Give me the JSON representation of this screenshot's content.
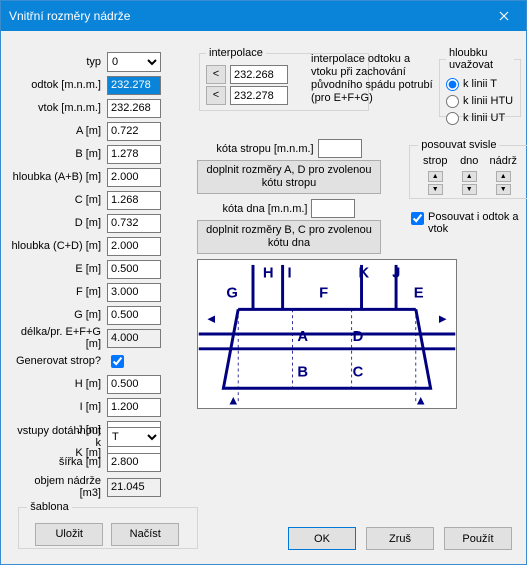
{
  "title": "Vnitřní rozměry nádrže",
  "fields": {
    "typ": {
      "label": "typ",
      "value": "0"
    },
    "odtok": {
      "label": "odtok [m.n.m.]",
      "value": "232.278"
    },
    "vtok": {
      "label": "vtok [m.n.m.]",
      "value": "232.268"
    },
    "A": {
      "label": "A [m]",
      "value": "0.722"
    },
    "B": {
      "label": "B [m]",
      "value": "1.278"
    },
    "AB": {
      "label": "hloubka (A+B) [m]",
      "value": "2.000"
    },
    "C": {
      "label": "C [m]",
      "value": "1.268"
    },
    "D": {
      "label": "D [m]",
      "value": "0.732"
    },
    "CD": {
      "label": "hloubka (C+D) [m]",
      "value": "2.000"
    },
    "E": {
      "label": "E [m]",
      "value": "0.500"
    },
    "F": {
      "label": "F [m]",
      "value": "3.000"
    },
    "G": {
      "label": "G [m]",
      "value": "0.500"
    },
    "EFG": {
      "label": "délka/pr. E+F+G [m]",
      "value": "4.000"
    },
    "gen": {
      "label": "Generovat strop?"
    },
    "H": {
      "label": "H [m]",
      "value": "0.500"
    },
    "I": {
      "label": "I [m]",
      "value": "1.200"
    },
    "J": {
      "label": "J [m]",
      "value": ""
    },
    "K": {
      "label": "K [m]",
      "value": ""
    }
  },
  "interp": {
    "legend": "interpolace",
    "v1": "232.268",
    "v2": "232.278",
    "desc": "interpolace odtoku a vtoku při zachování původního spádu potrubí (pro E+F+G)"
  },
  "depth": {
    "legend": "hloubku uvažovat",
    "opt1": "k linii T",
    "opt2": "k linii HTU",
    "opt3": "k linii UT"
  },
  "kota1": {
    "label": "kóta stropu [m.n.m.]",
    "btn": "doplnit rozměry A, D pro zvolenou kótu stropu"
  },
  "kota2": {
    "label": "kóta dna [m.n.m.]",
    "btn": "doplnit rozměry B, C pro zvolenou kótu dna"
  },
  "posun": {
    "legend": "posouvat svisle",
    "c1": "strop",
    "c2": "dno",
    "c3": "nádrž",
    "chk": "Posouvat i odtok a vtok"
  },
  "vstupy": {
    "label": "vstupy dotáhnout k",
    "value": "T"
  },
  "sirka": {
    "label": "šířka [m]",
    "value": "2.800"
  },
  "objem": {
    "label": "objem nádrže [m3]",
    "value": "21.045"
  },
  "sablona": {
    "legend": "šablona",
    "save": "Uložit",
    "load": "Načíst"
  },
  "buttons": {
    "ok": "OK",
    "cancel": "Zruš",
    "apply": "Použít"
  }
}
